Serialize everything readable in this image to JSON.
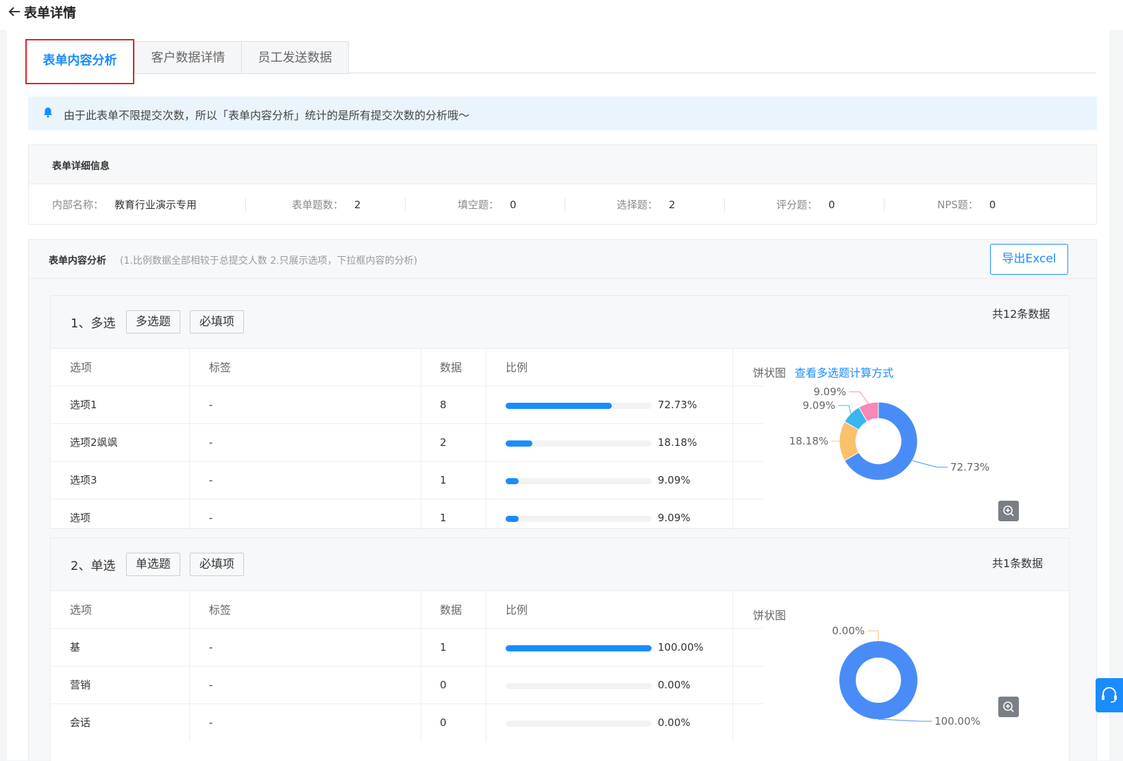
{
  "header": {
    "title": "表单详情"
  },
  "tabs": [
    {
      "label": "表单内容分析"
    },
    {
      "label": "客户数据详情"
    },
    {
      "label": "员工发送数据"
    }
  ],
  "notice": {
    "text": "由于此表单不限提交次数，所以「表单内容分析」统计的是所有提交次数的分析哦～"
  },
  "details": {
    "title": "表单详细信息",
    "fields": [
      {
        "label": "内部名称：",
        "value": "教育行业演示专用"
      },
      {
        "label": "表单题数：",
        "value": "2"
      },
      {
        "label": "填空题：",
        "value": "0"
      },
      {
        "label": "选择题：",
        "value": "2"
      },
      {
        "label": "评分题：",
        "value": "0"
      },
      {
        "label": "NPS题：",
        "value": "0"
      }
    ]
  },
  "analysis": {
    "title": "表单内容分析",
    "subtitle": "(1.比例数据全部相较于总提交人数 2.只展示选项，下拉框内容的分析)",
    "export_label": "导出Excel",
    "columns": {
      "option": "选项",
      "tag": "标签",
      "count": "数据",
      "ratio": "比例"
    },
    "pie_label": "饼状图",
    "questions": [
      {
        "title": "1、多选",
        "tags": [
          "多选题",
          "必填项"
        ],
        "count_text": "共12条数据",
        "pie_link": "查看多选题计算方式",
        "rows": [
          {
            "option": "选项1",
            "tag": "-",
            "count": "8",
            "ratio": 0.7273,
            "ratio_text": "72.73%"
          },
          {
            "option": "选项2飒飒",
            "tag": "-",
            "count": "2",
            "ratio": 0.1818,
            "ratio_text": "18.18%"
          },
          {
            "option": "选项3",
            "tag": "-",
            "count": "1",
            "ratio": 0.0909,
            "ratio_text": "9.09%"
          },
          {
            "option": "选项",
            "tag": "-",
            "count": "1",
            "ratio": 0.0909,
            "ratio_text": "9.09%"
          }
        ],
        "pie_slices": [
          {
            "value": 72.73,
            "label": "72.73%",
            "color": "#4a8cf7"
          },
          {
            "value": 18.18,
            "label": "18.18%",
            "color": "#f9c16d"
          },
          {
            "value": 9.09,
            "label": "9.09%",
            "color": "#37b6f0"
          },
          {
            "value": 9.09,
            "label": "9.09%",
            "color": "#f788b8"
          }
        ]
      },
      {
        "title": "2、单选",
        "tags": [
          "单选题",
          "必填项"
        ],
        "count_text": "共1条数据",
        "pie_link": "",
        "rows": [
          {
            "option": "基",
            "tag": "-",
            "count": "1",
            "ratio": 1.0,
            "ratio_text": "100.00%"
          },
          {
            "option": "营销",
            "tag": "-",
            "count": "0",
            "ratio": 0,
            "ratio_text": "0.00%"
          },
          {
            "option": "会话",
            "tag": "-",
            "count": "0",
            "ratio": 0,
            "ratio_text": "0.00%"
          }
        ],
        "pie_slices": [
          {
            "value": 100,
            "label": "100.00%",
            "color": "#4a8cf7"
          },
          {
            "value": 0,
            "label": "0.00%",
            "color": "#f9c16d"
          }
        ]
      }
    ]
  },
  "colors": {
    "accent": "#1a8cff",
    "active_tab_border": "#e02020"
  },
  "icons": {
    "back": "arrow-left-icon",
    "notice": "bell-icon",
    "zoom": "zoom-in-icon",
    "help": "headset-icon"
  }
}
